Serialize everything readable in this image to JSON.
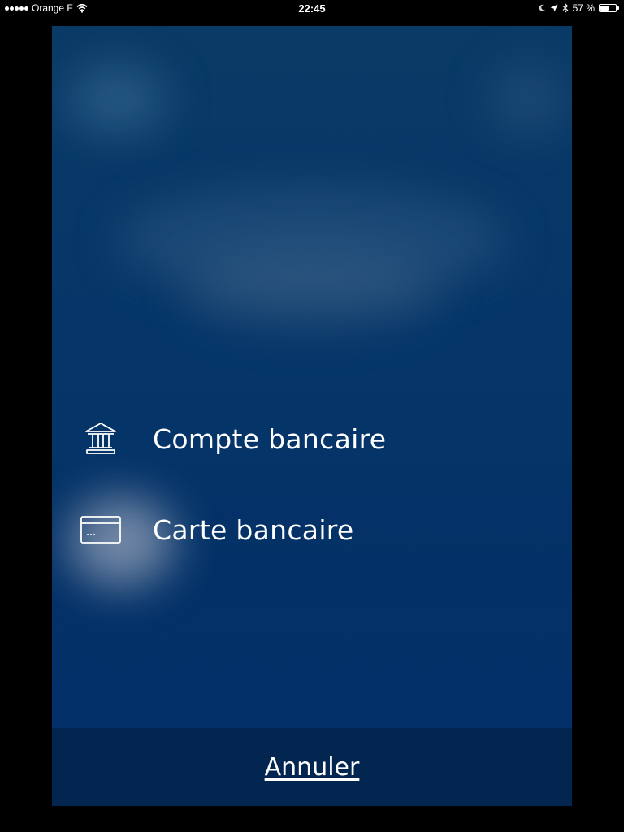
{
  "status_bar": {
    "carrier": "Orange F",
    "time": "22:45",
    "battery_percent": "57 %",
    "battery_level": 0.57
  },
  "menu": {
    "items": [
      {
        "icon": "bank-icon",
        "label": "Compte bancaire"
      },
      {
        "icon": "credit-card-icon",
        "label": "Carte bancaire"
      }
    ]
  },
  "footer": {
    "cancel_label": "Annuler"
  },
  "colors": {
    "sheet_background": "#063669",
    "footer_background": "#032650",
    "text": "#ffffff",
    "outer_background": "#000000"
  }
}
